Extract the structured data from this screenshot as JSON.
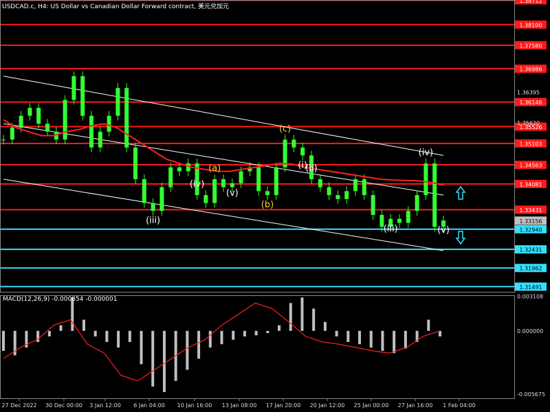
{
  "window": {
    "title": "USDCAD.c, H4:  US Dollar vs Canadian Dollar Forward contract, 美元兑加元",
    "macd_title": "MACD(12,26,9) -0.000854 -0.000001"
  },
  "colors": {
    "background": "#000000",
    "candle": "#33ff33",
    "resistance": "#ff1a1a",
    "support": "#33e0ff",
    "ma": "#ff2020",
    "channel": "#ffffff",
    "histogram": "#c0c0c0",
    "signal": "#ff2020",
    "price_tag": "#ff0000",
    "current_tag": "#c0c0c0"
  },
  "chart_data": [
    {
      "type": "candlestick",
      "title": "USDCAD.c, H4:  US Dollar vs Canadian Dollar Forward contract, 美元兑加元",
      "ylim": [
        1.3136,
        1.3872
      ],
      "x_ticks": [
        "27 Dec 2022",
        "30 Dec 00:00",
        "3 Jan 12:00",
        "6 Jan 04:00",
        "10 Jan 16:00",
        "13 Jan 08:00",
        "17 Jan 20:00",
        "20 Jan 12:00",
        "25 Jan 00:00",
        "27 Jan 16:00",
        "1 Feb 04:00"
      ],
      "y_ticks": [
        "1.36395",
        "1.35620"
      ],
      "resistance_levels": [
        {
          "label": "1.38712",
          "value": 1.38712
        },
        {
          "label": "1.38100",
          "value": 1.381
        },
        {
          "label": "1.37580",
          "value": 1.3758
        },
        {
          "label": "1.36986",
          "value": 1.36986
        },
        {
          "label": "1.36146",
          "value": 1.36146
        },
        {
          "label": "1.35526",
          "value": 1.35526
        },
        {
          "label": "1.35103",
          "value": 1.35103
        },
        {
          "label": "1.34563",
          "value": 1.34563
        },
        {
          "label": "1.34081",
          "value": 1.34081
        },
        {
          "label": "1.33431",
          "value": 1.33431
        }
      ],
      "support_levels": [
        {
          "label": "1.32940",
          "value": 1.3294
        },
        {
          "label": "1.32431",
          "value": 1.32431
        },
        {
          "label": "1.31962",
          "value": 1.31962
        },
        {
          "label": "1.31491",
          "value": 1.31491
        }
      ],
      "current_price": {
        "label": "1.33156",
        "value": 1.33156
      },
      "series": [
        {
          "values": [
            1.352,
            1.355,
            1.358,
            1.36,
            1.356,
            1.354,
            1.352,
            1.362,
            1.368,
            1.358,
            1.35,
            1.354,
            1.358,
            1.365,
            1.35,
            1.342,
            1.336,
            1.334,
            1.34,
            1.345,
            1.344,
            1.346,
            1.338,
            1.336,
            1.342,
            1.34,
            1.341,
            1.344,
            1.345,
            1.339,
            1.338,
            1.345,
            1.352,
            1.35,
            1.348,
            1.342,
            1.34,
            1.338,
            1.337,
            1.339,
            1.342,
            1.338,
            1.333,
            1.33,
            1.332,
            1.331,
            1.334,
            1.338,
            1.346,
            1.33,
            1.3316
          ]
        },
        {
          "values": [
            1.357,
            1.355,
            1.354,
            1.353,
            1.353,
            1.354,
            1.3545,
            1.3555,
            1.356,
            1.355,
            1.353,
            1.351,
            1.349,
            1.347,
            1.346,
            1.345,
            1.3445,
            1.344,
            1.344,
            1.3445,
            1.345,
            1.3455,
            1.346,
            1.3458,
            1.345,
            1.3445,
            1.344,
            1.3435,
            1.343,
            1.3425,
            1.342,
            1.3418,
            1.3417,
            1.3416,
            1.3412,
            1.3405
          ]
        }
      ],
      "channel_lines": [
        {
          "from": [
            1.368,
            1.35
          ],
          "to": [
            1.348,
            1.345
          ]
        },
        {
          "from": [
            1.356,
            1.335
          ],
          "to": [
            1.338,
            1.33
          ]
        },
        {
          "from": [
            1.342,
            1.316
          ],
          "to": [
            1.324,
            1.318
          ]
        }
      ],
      "wave_labels": [
        {
          "text": "(iii)",
          "color": "#ffffff"
        },
        {
          "text": "(iv)",
          "color": "#ffffff"
        },
        {
          "text": "(a)",
          "color": "#ffcc33"
        },
        {
          "text": "(v)",
          "color": "#ffffff"
        },
        {
          "text": "(b)",
          "color": "#ffcc33"
        },
        {
          "text": "(c)",
          "color": "#ffcc33"
        },
        {
          "text": "(i)",
          "color": "#ffffff"
        },
        {
          "text": "(ii)",
          "color": "#ffffff"
        },
        {
          "text": "(iii)",
          "color": "#ffffff"
        },
        {
          "text": "(iv)",
          "color": "#ffffff"
        },
        {
          "text": "(v)",
          "color": "#ffffff"
        }
      ],
      "arrows": [
        {
          "name": "up-arrow",
          "direction": "up"
        },
        {
          "name": "down-arrow",
          "direction": "down"
        }
      ]
    },
    {
      "type": "bar",
      "title": "MACD(12,26,9) -0.000854 -0.000001",
      "ylim": [
        -0.00606,
        0.0032
      ],
      "y_ticks": [
        "0.003108",
        "0.000000",
        "-0.005675"
      ],
      "histogram": [
        -0.0018,
        -0.0022,
        -0.0015,
        -0.001,
        -0.0005,
        0.0005,
        0.003,
        0.001,
        -0.0005,
        -0.001,
        -0.0015,
        -0.001,
        -0.003,
        -0.005,
        -0.0055,
        -0.0045,
        -0.0035,
        -0.0025,
        -0.0015,
        -0.0012,
        -0.0008,
        -0.0005,
        -0.0004,
        -0.0002,
        0.0005,
        0.0025,
        0.003,
        0.002,
        0.0008,
        -0.0005,
        -0.001,
        -0.0012,
        -0.0015,
        -0.0018,
        -0.002,
        -0.0016,
        -0.001,
        0.001,
        -0.0005
      ],
      "signal": [
        -0.0025,
        -0.0015,
        -0.0008,
        0.0005,
        0.001,
        -0.0012,
        -0.002,
        -0.004,
        -0.0045,
        -0.0035,
        -0.0025,
        -0.0015,
        -0.0008,
        0.0005,
        0.0015,
        0.0025,
        0.002,
        0.0008,
        -0.0005,
        -0.001,
        -0.0012,
        -0.0015,
        -0.0018,
        -0.002,
        -0.0015,
        -0.0005,
        0.0
      ]
    }
  ]
}
